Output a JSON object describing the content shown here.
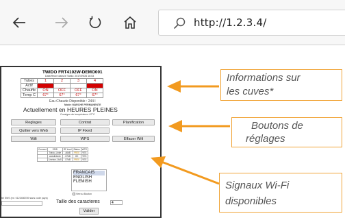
{
  "browser": {
    "url": "http://1.2.3.4/",
    "back_icon": "back-arrow-icon",
    "forward_icon": "forward-arrow-icon",
    "refresh_icon": "refresh-icon",
    "home_icon": "home-icon",
    "search_icon": "search-icon"
  },
  "page": {
    "title": "TWIDO FRT4102W-DEMO001",
    "datetime": "Date/Heure dans le Twido: 2017/09/26 16:53",
    "cuves": {
      "columns": [
        "Tubes",
        "1",
        "2",
        "3",
        "4"
      ],
      "rows": [
        {
          "label": "Actif",
          "cells": [
            "",
            "",
            "",
            ""
          ]
        },
        {
          "label": "Chauffe",
          "cells": [
            "ON",
            "OFF",
            "OFF",
            "ON"
          ]
        },
        {
          "label": "Temp C",
          "cells": [
            "67°",
            "67°",
            "67°",
            "67°"
          ]
        }
      ]
    },
    "eau_chaude": "Eau Chaude Disponible : 244 l",
    "mode": "Mode: MARCHE PERMANENTE",
    "heures": "Actuellement en HEURES PLEINES",
    "consigne": "Consigne de température: 67°C",
    "buttons": {
      "reglages": "Reglages",
      "contrat": "Contrat",
      "planification": "Planification",
      "quitter_web": "Quitter vers Web",
      "ip_fixed": "IP Fixed",
      "wifi": "Wifi",
      "wps": "WPS",
      "effacer_wifi": "Effacer Wifi"
    },
    "wifi_table": {
      "header": [
        "Connect",
        "SSID",
        "RF level",
        "Status",
        "WPS"
      ],
      "rows": [
        [
          "",
          "Twido_Linke",
          "-46dB",
          "FREE",
          "YES"
        ],
        [
          "",
          "wwwlinkedx",
          "-57dB",
          "OK",
          "YES"
        ],
        [
          "",
          "Livebox-14c5",
          "-57dB",
          "FREE",
          "YES"
        ]
      ]
    },
    "languages": [
      "FRANCAIS",
      "ENGLISH",
      "FLEMISH"
    ],
    "selected_language": "FRANCAIS",
    "verrou_label": "Verrou Bouton",
    "tel_label": "tel SMS (ex: 0123456789 sans code pays)",
    "taille_label": "Taille des caracteres",
    "taille_value": "4",
    "valider": "Valider"
  },
  "callouts": {
    "cuves": [
      "Informations sur",
      "les cuves*"
    ],
    "boutons": [
      "Boutons de",
      "réglages"
    ],
    "wifi": [
      "Signaux Wi-Fi",
      "disponibles"
    ]
  },
  "colors": {
    "callout_border": "#f0a335",
    "arrow": "#f29a1f",
    "actif_cell": "#d40000"
  }
}
